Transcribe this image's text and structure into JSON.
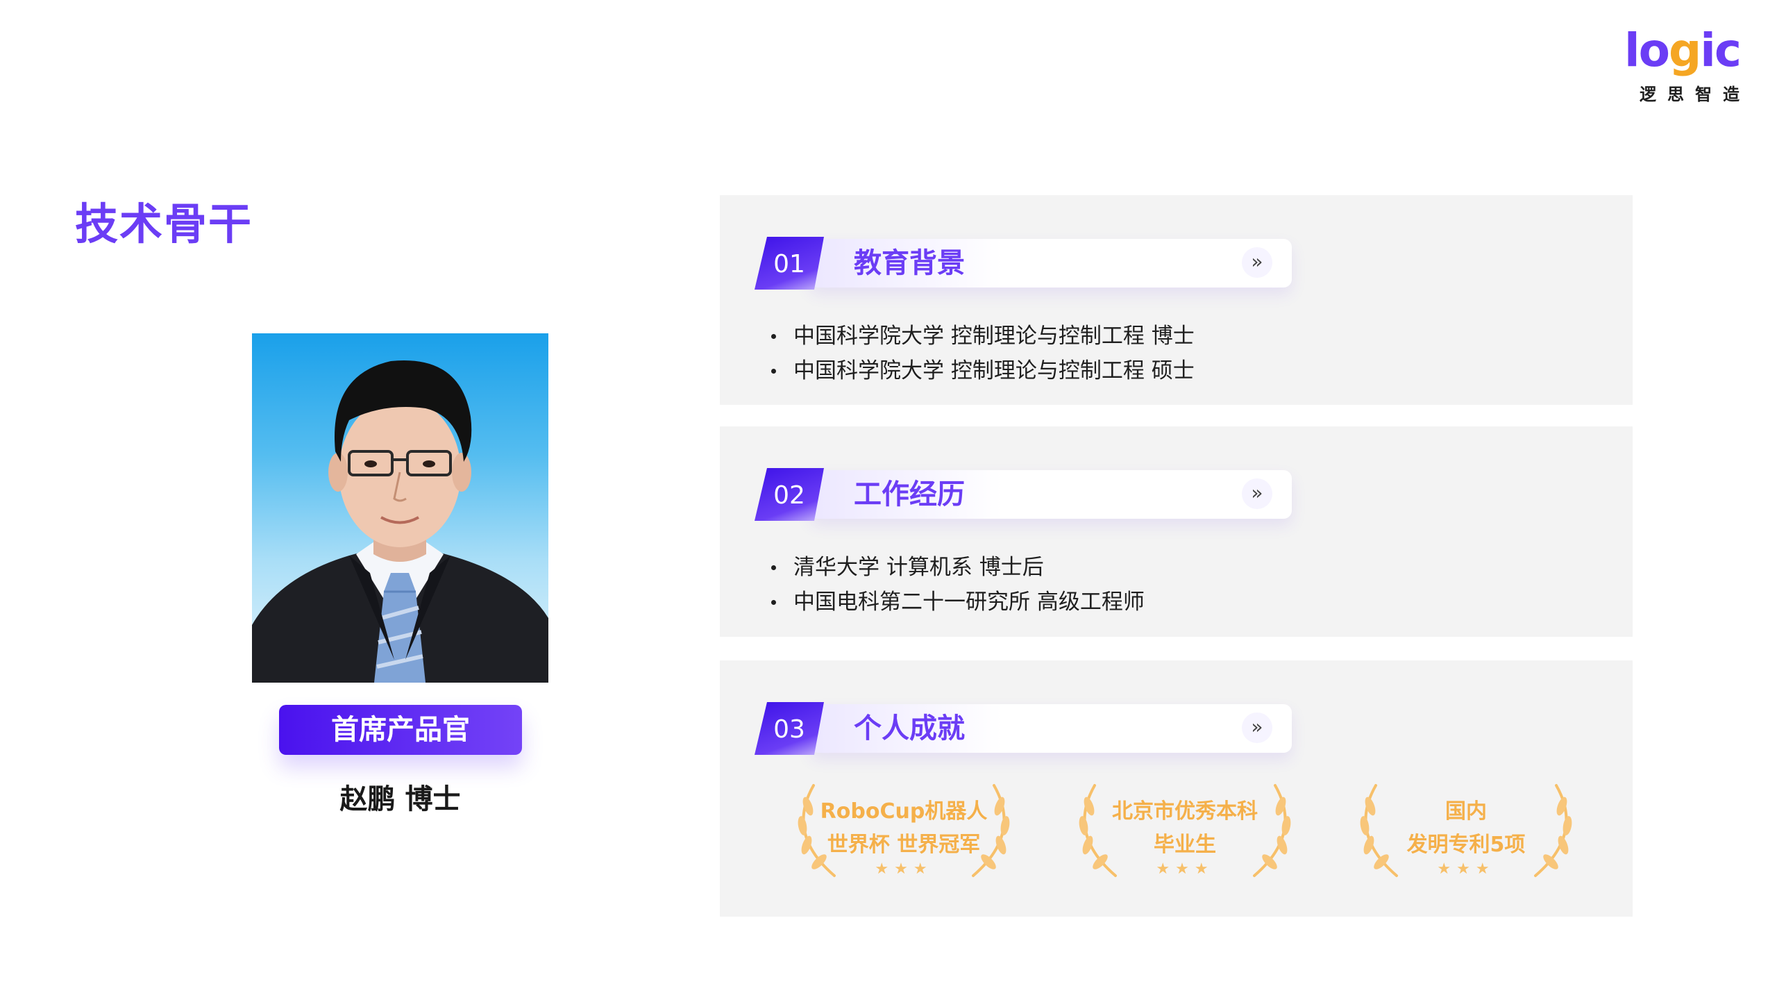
{
  "logo": {
    "word_pre": "lo",
    "word_g": "g",
    "word_post": "ic",
    "cn": "逻思智造"
  },
  "page_title": "技术骨干",
  "person": {
    "role": "首席产品官",
    "name": "赵鹏 博士"
  },
  "sections": [
    {
      "num": "01",
      "title": "教育背景",
      "items": [
        "中国科学院大学 控制理论与控制工程 博士",
        "中国科学院大学 控制理论与控制工程 硕士"
      ]
    },
    {
      "num": "02",
      "title": "工作经历",
      "items": [
        "清华大学 计算机系 博士后",
        "中国电科第二十一研究所 高级工程师"
      ]
    },
    {
      "num": "03",
      "title": "个人成就"
    }
  ],
  "awards": [
    {
      "line1": "RoboCup机器人",
      "line2": "世界杯 世界冠军",
      "stars": "★★★"
    },
    {
      "line1": "北京市优秀本科",
      "line2": "毕业生",
      "stars": "★★★"
    },
    {
      "line1": "国内",
      "line2": "发明专利5项",
      "stars": "★★★"
    }
  ],
  "icons": {
    "chevron": "double-chevron-right-icon",
    "wreath": "laurel-wreath-icon",
    "stars": "star-icon"
  },
  "colors": {
    "brand_purple": "#6b3df5",
    "brand_orange": "#f5a623",
    "award_gold": "#f5b04a",
    "card_bg": "#f3f3f3"
  }
}
